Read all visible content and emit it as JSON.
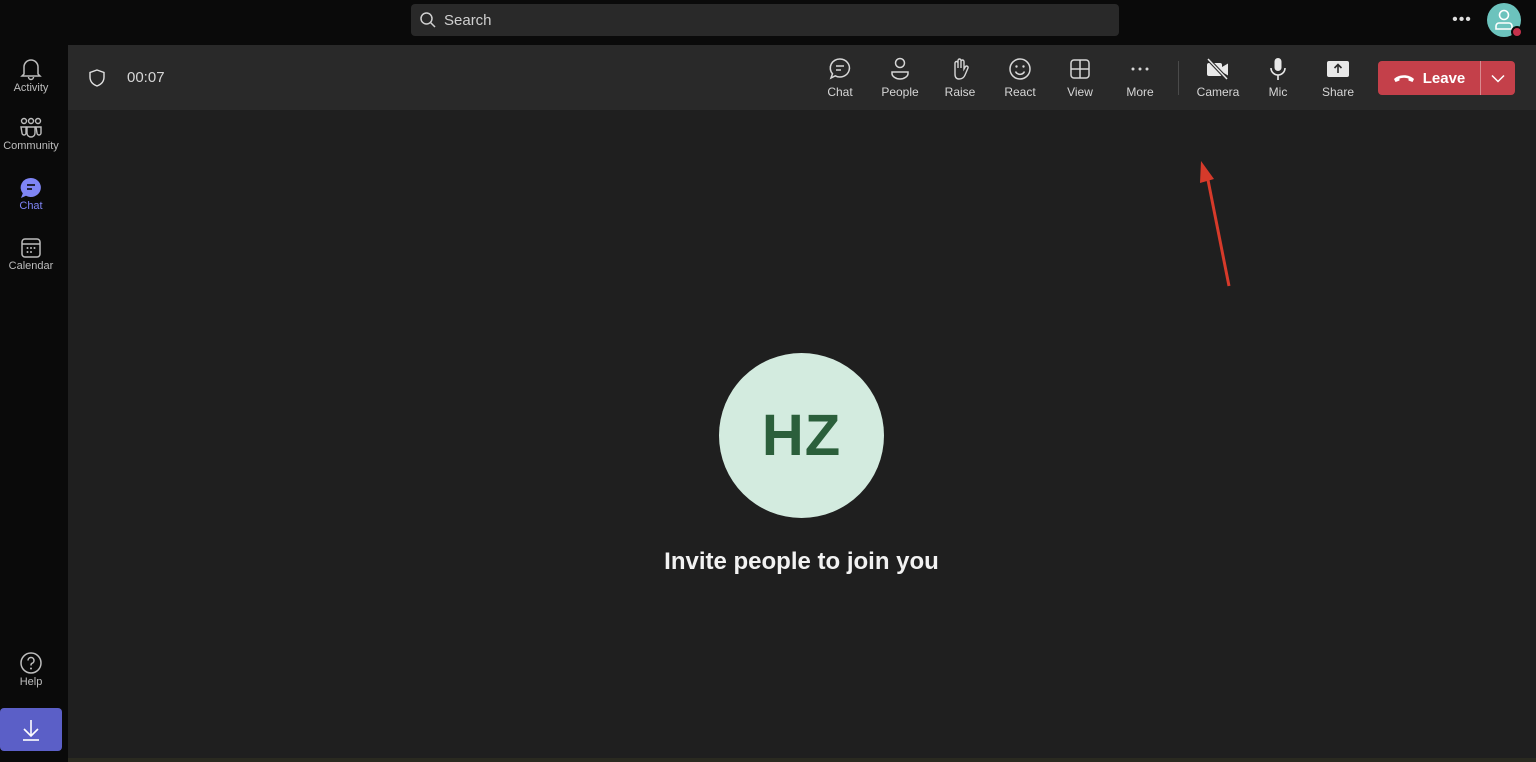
{
  "search": {
    "placeholder": "Search"
  },
  "topbar": {
    "more_icon": "more-horizontal-icon",
    "avatar_status_color": "#c4314b"
  },
  "rail": {
    "items": [
      {
        "label": "Activity",
        "icon": "bell-icon"
      },
      {
        "label": "Community",
        "icon": "community-icon"
      },
      {
        "label": "Chat",
        "icon": "chat-icon",
        "active": true
      },
      {
        "label": "Calendar",
        "icon": "calendar-icon"
      }
    ],
    "help_label": "Help",
    "download_icon": "download-icon"
  },
  "call": {
    "timer": "00:07",
    "controls": [
      {
        "label": "Chat",
        "icon": "chat-bubble-icon"
      },
      {
        "label": "People",
        "icon": "people-icon"
      },
      {
        "label": "Raise",
        "icon": "raise-hand-icon"
      },
      {
        "label": "React",
        "icon": "smiley-icon"
      },
      {
        "label": "View",
        "icon": "grid-view-icon"
      },
      {
        "label": "More",
        "icon": "more-icon"
      },
      {
        "label": "Camera",
        "icon": "camera-off-icon"
      },
      {
        "label": "Mic",
        "icon": "mic-icon"
      },
      {
        "label": "Share",
        "icon": "share-icon"
      }
    ],
    "leave_label": "Leave",
    "leave_color": "#c4404a"
  },
  "stage": {
    "avatar_initials": "HZ",
    "avatar_bg": "#d3ebdf",
    "invite_text": "Invite people to join you"
  },
  "annotation": {
    "arrow_color": "#d63a2a"
  }
}
